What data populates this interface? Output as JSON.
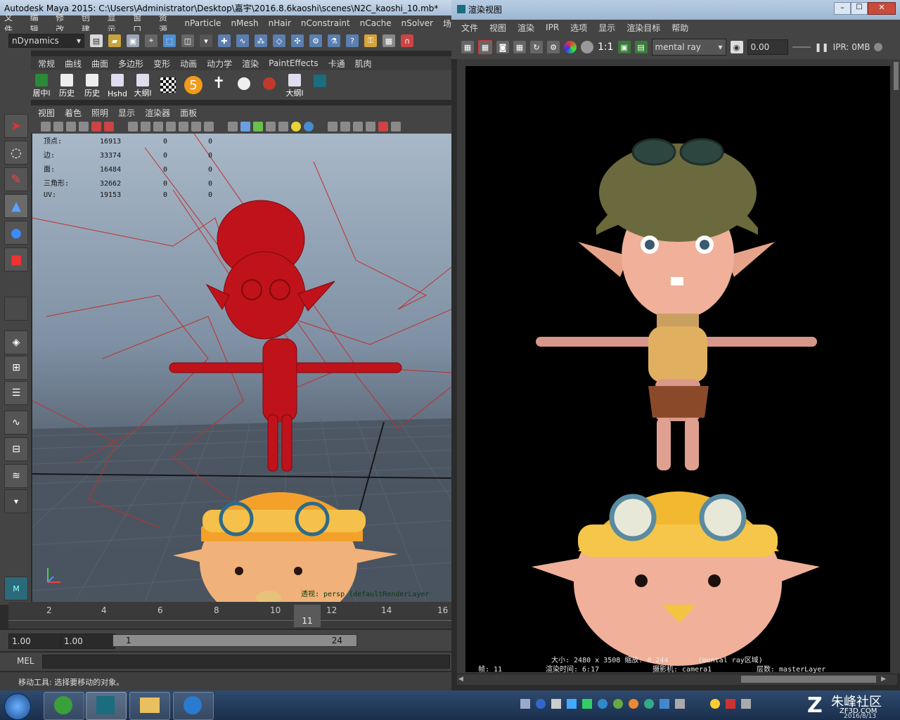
{
  "maya": {
    "title": "Autodesk Maya 2015: C:\\Users\\Administrator\\Desktop\\嘉宇\\2016.8.6kaoshi\\scenes\\N2C_kaoshi_10.mb*",
    "menus": [
      "文件",
      "编辑",
      "修改",
      "创建",
      "显示",
      "窗口",
      "资源",
      "nParticle",
      "nMesh",
      "nHair",
      "nConstraint",
      "nCache",
      "nSolver",
      "场"
    ],
    "menu_set": "nDynamics",
    "shelf_tabs": [
      "常规",
      "曲线",
      "曲面",
      "多边形",
      "变形",
      "动画",
      "动力学",
      "渲染",
      "PaintEffects",
      "卡通",
      "肌肉"
    ],
    "shelf_buttons": [
      {
        "label": "居中l",
        "icon": "pivot-icon"
      },
      {
        "label": "历史",
        "icon": "history-icon"
      },
      {
        "label": "历史",
        "icon": "history-icon"
      },
      {
        "label": "Hshd",
        "icon": "hypershade-icon"
      },
      {
        "label": "大纲l",
        "icon": "outliner-icon"
      },
      {
        "label": "",
        "icon": "checker-icon"
      },
      {
        "label": "5",
        "icon": "number-badge-icon"
      },
      {
        "label": "",
        "icon": "skeleton-icon"
      },
      {
        "label": "",
        "icon": "skull-icon"
      },
      {
        "label": "",
        "icon": "paint-icon"
      },
      {
        "label": "大纲l",
        "icon": "outliner-icon"
      },
      {
        "label": "",
        "icon": "maya-logo-icon"
      }
    ],
    "panel_menus": [
      "视图",
      "着色",
      "照明",
      "显示",
      "渲染器",
      "面板"
    ],
    "hud": [
      {
        "label": "顶点:",
        "v1": "16913",
        "v2": "0",
        "v3": "0"
      },
      {
        "label": "边:",
        "v1": "33374",
        "v2": "0",
        "v3": "0"
      },
      {
        "label": "面:",
        "v1": "16484",
        "v2": "0",
        "v3": "0"
      },
      {
        "label": "三角形:",
        "v1": "32662",
        "v2": "0",
        "v3": "0"
      },
      {
        "label": "UV:",
        "v1": "19153",
        "v2": "0",
        "v3": "0"
      }
    ],
    "camera_label": "透视: persp (defaultRenderLayer",
    "timeline_ticks": [
      "2",
      "4",
      "6",
      "8",
      "10",
      "12",
      "14",
      "16"
    ],
    "current_frame": "11",
    "range_start": "1.00",
    "range_start2": "1.00",
    "range_handle_start": "1",
    "range_handle_end": "24",
    "mel_label": "MEL",
    "help_text": "移动工具: 选择要移动的对象。"
  },
  "render_view": {
    "title": "渲染视图",
    "menus": [
      "文件",
      "视图",
      "渲染",
      "IPR",
      "选项",
      "显示",
      "渲染目标",
      "帮助"
    ],
    "renderer": "mental ray",
    "exposure": "0.00",
    "ratio_label": "1:1",
    "ipr_memory": "IPR: 0MB",
    "info_line1": "大小: 2480 x 3508 缩放: 0.244       (mental ray区域)",
    "info_frame": "帧: 11",
    "info_time": "渲染时间: 6:17",
    "info_camera": "摄影机: camera1",
    "info_layer": "层数: masterLayer"
  },
  "taskbar": {
    "watermark": "朱峰社区",
    "watermark_sub": "ZF3D.COM",
    "date": "2016/8/13"
  },
  "colors": {
    "maya_bg": "#444444",
    "title_blue": "#a9bfd8",
    "character_red": "#c0121a",
    "taskbar": "#1a2f4c"
  }
}
